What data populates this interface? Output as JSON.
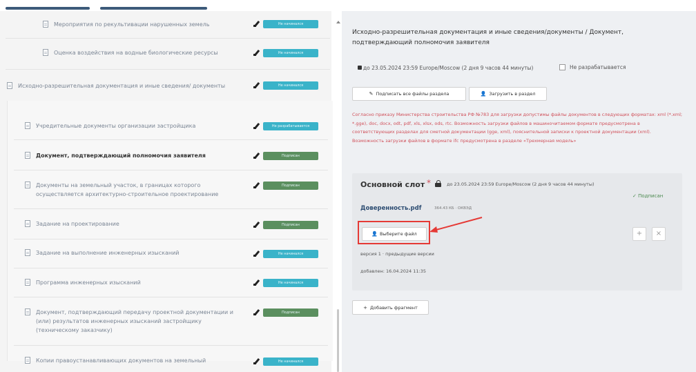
{
  "tree": {
    "items": [
      {
        "label": "Мероприятия по рекультивации нарушенных земель",
        "status": "Не начинался",
        "status_color": "cyan"
      },
      {
        "label": "Оценка воздействия на водные биологические ресурсы",
        "status": "Не начинался",
        "status_color": "cyan"
      },
      {
        "label": "Исходно-разрешительная документация и иные сведения/ документы",
        "status": "Не начинался",
        "status_color": "cyan"
      },
      {
        "label": "Учредительные документы организации застройщика",
        "status": "Не разрабатывается",
        "status_color": "cyan"
      },
      {
        "label": "Документ, подтверждающий полномочия заявителя",
        "status": "Подписан",
        "status_color": "green"
      },
      {
        "label": "Документы на земельный участок, в границах которого осуществляется архитектурно-строительное проектирование",
        "status": "Подписан",
        "status_color": "green"
      },
      {
        "label": "Задание на проектирование",
        "status": "Подписан",
        "status_color": "green"
      },
      {
        "label": "Задание на выполнение инженерных изысканий",
        "status": "Не начинался",
        "status_color": "cyan"
      },
      {
        "label": "Программа инженерных изысканий",
        "status": "Не начинался",
        "status_color": "cyan"
      },
      {
        "label": "Документ, подтверждающий передачу проектной документации и (или) результатов инженерных изысканий застройщику (техническому заказчику)",
        "status": "Подписан",
        "status_color": "green"
      },
      {
        "label": "Копии правоустанавливающих документов на земельный",
        "status": "Не начинался",
        "status_color": "cyan"
      }
    ]
  },
  "document": {
    "title": "Исходно-разрешительная документация и иные сведения/документы / Документ, подтверждающий полномочия заявителя",
    "deadline": "до 23.05.2024 23:59 Europe/Moscow (2 дня 9 часов 44 минуты)",
    "not_developed_label": "Не разрабатывается",
    "sign_all_label": "Подписать все файлы раздела",
    "upload_label": "Загрузить в раздел",
    "note": "Согласно приказу Министерства строительства РФ №783 для загрузки допустимы файлы документов в следующих форматах: xml (*.xml; *.gge), doc, docx, odt, pdf, xls, xlsx, ods, rtc. Возможность загрузки файлов в машиночитаемом формате предусмотрена в соответствующих разделах для сметной документации (gge, xml), пояснительной записки к проектной документации (xml). Возможность загрузки файлов в формате ifc предусмотрена в разделе «Трехмерная модель»"
  },
  "slot": {
    "title": "Основной слот",
    "required_mark": "*",
    "deadline": "до 23.05.2024 23:59 Europe/Moscow (2 дня 9 часов 44 минуты)",
    "signed_label": "✓ Подписан",
    "file_name": "Доверенность.pdf",
    "file_size": "364.43 КБ · ОКВЭД",
    "choose_file_label": "Выберите файл",
    "version": "версия 1 · предыдущие версии",
    "added": "добавлен: 16.04.2024 11:35"
  },
  "add_fragment_label": "Добавить фрагмент",
  "colors": {
    "accent": "#3c5a7a",
    "badge_cyan": "#3ab3c9",
    "badge_green": "#5b8f5f",
    "note_red": "#d0505a",
    "highlight": "#e53935"
  }
}
